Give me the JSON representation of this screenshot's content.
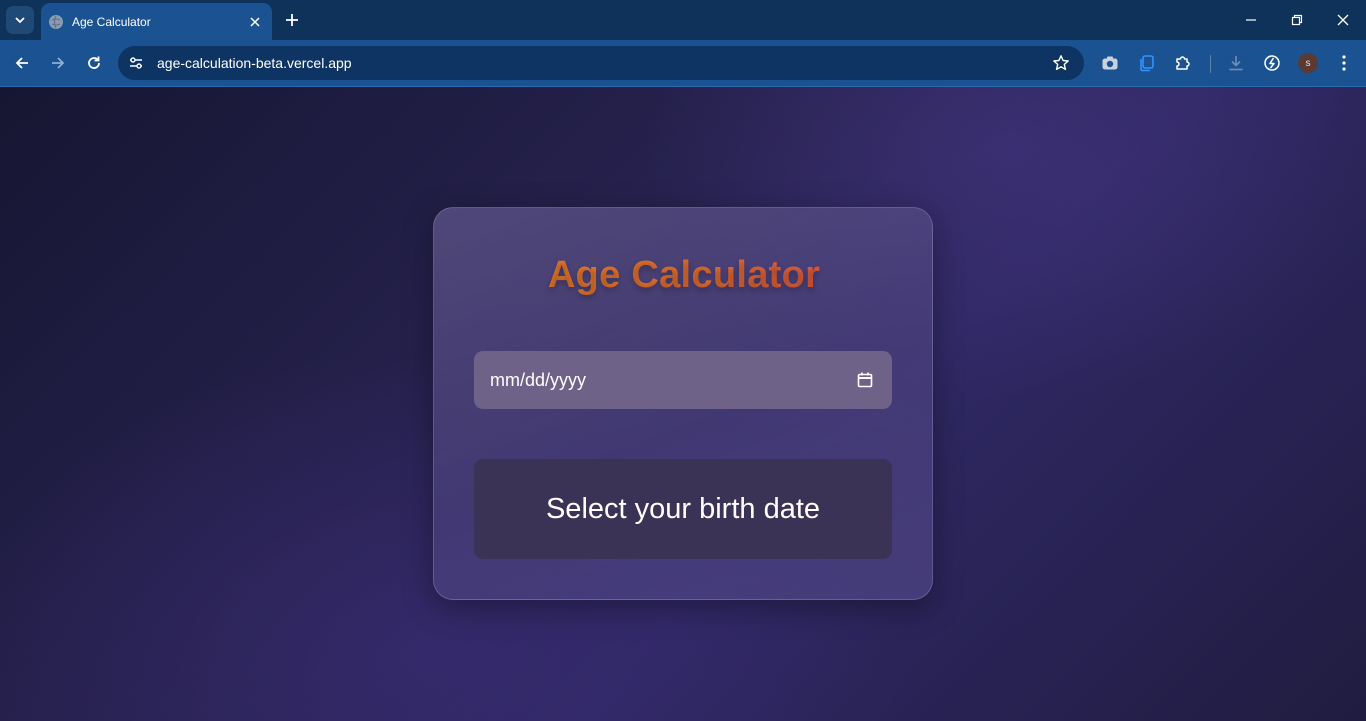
{
  "browser": {
    "tab": {
      "title": "Age Calculator"
    },
    "address_bar": {
      "url": "age-calculation-beta.vercel.app"
    },
    "profile_initial": "s"
  },
  "app": {
    "title": "Age Calculator",
    "date_input": {
      "placeholder": "mm/dd/yyyy"
    },
    "result": {
      "text": "Select your birth date"
    }
  },
  "icons": {
    "tab_search": "chevron-down-icon",
    "favicon": "globe-icon",
    "tab_close": "close-icon",
    "new_tab": "plus-icon",
    "minimize": "minimize-icon",
    "restore": "restore-icon",
    "close_window": "close-icon",
    "back": "arrow-left-icon",
    "forward": "arrow-right-icon",
    "reload": "reload-icon",
    "site_info": "tune-icon",
    "bookmark": "star-icon",
    "camera_ext": "camera-icon",
    "copy_ext": "copy-icon",
    "extensions": "puzzle-icon",
    "downloads": "download-icon",
    "performance": "speedometer-icon",
    "menu": "kebab-menu-icon",
    "calendar": "calendar-icon"
  },
  "colors": {
    "title_gradient_start": "#e9822a",
    "title_gradient_end": "#d84a52",
    "page_background": "#27224f",
    "input_background": "#6e6288",
    "result_background": "#3b3356"
  }
}
